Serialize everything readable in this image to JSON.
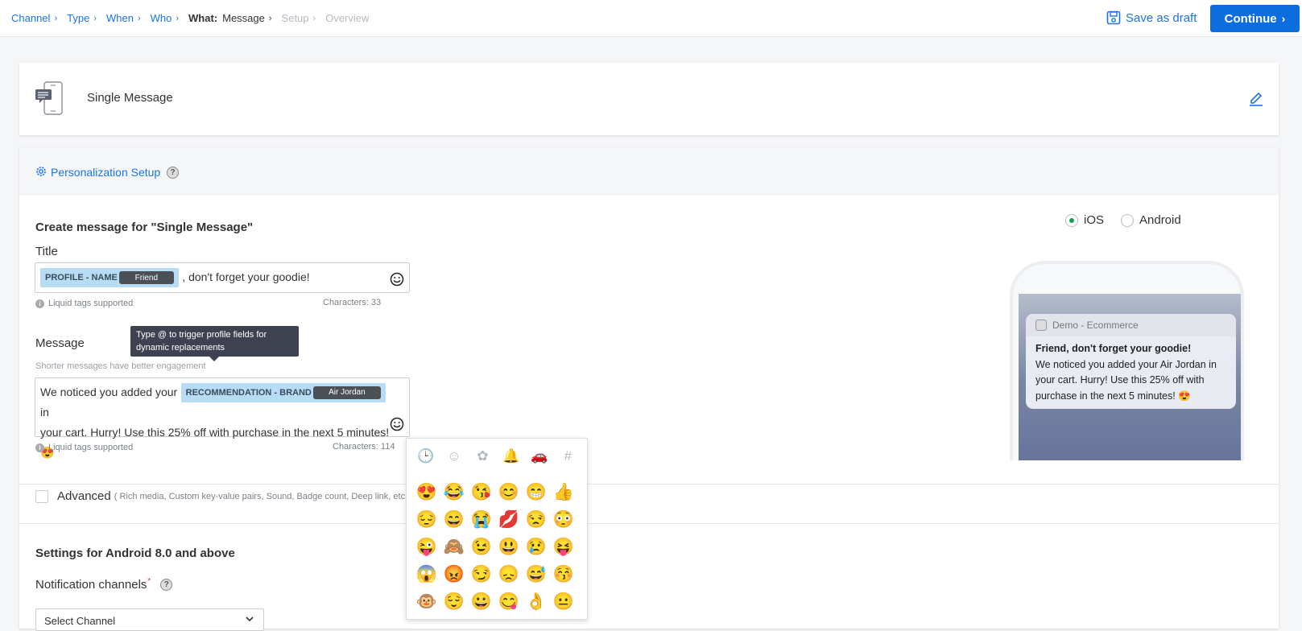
{
  "breadcrumb": {
    "items": [
      "Channel",
      "Type",
      "When",
      "Who"
    ],
    "current_prefix": "What:",
    "current_label": "Message",
    "disabled": [
      "Setup",
      "Overview"
    ]
  },
  "actions": {
    "save_draft": "Save as draft",
    "continue": "Continue"
  },
  "campaign": {
    "name": "Single Message"
  },
  "personalization": {
    "label": "Personalization Setup"
  },
  "form": {
    "heading": "Create message for \"Single Message\"",
    "platforms": [
      {
        "label": "iOS",
        "selected": true
      },
      {
        "label": "Android",
        "selected": false
      }
    ],
    "title": {
      "label": "Title",
      "tag_name": "PROFILE - NAME",
      "tag_value": "Friend",
      "text_after": ", don't forget your goodie!",
      "hint": "Liquid tags supported",
      "characters": "Characters: 33"
    },
    "message": {
      "label": "Message",
      "sub": "Shorter messages have better engagement",
      "text_before": "We noticed you added your",
      "tag_name": "RECOMMENDATION - BRAND",
      "tag_value": "Air Jordan",
      "text_after_1": "in",
      "text_after_2": "your cart. Hurry! Use this 25% off with purchase in the next 5 minutes! 😍",
      "hint": "Liquid tags supported",
      "characters": "Characters: 114"
    },
    "tooltip": "Type @ to trigger profile fields for dynamic replacements"
  },
  "advanced": {
    "label": "Advanced",
    "sub": "( Rich media, Custom key-value pairs, Sound, Badge count, Deep link, etc. )"
  },
  "android": {
    "heading": "Settings for Android 8.0 and above",
    "channels_label": "Notification channels",
    "required_mark": "*",
    "select_placeholder": "Select Channel"
  },
  "preview": {
    "app_name": "Demo - Ecommerce",
    "title": "Friend, don't forget your goodie!",
    "body": "We noticed you added your Air Jordan in your cart. Hurry! Use this 25% off with purchase in the next 5 minutes! 😍"
  },
  "emoji_picker": {
    "tabs": [
      "clock-icon",
      "smiley-icon",
      "flower-icon",
      "bell-icon",
      "car-icon",
      "hash-icon"
    ],
    "tab_glyphs": [
      "🕒",
      "☺",
      "✿",
      "🔔",
      "🚗",
      "#"
    ],
    "emojis": [
      "😍",
      "😂",
      "😘",
      "😊",
      "😁",
      "👍",
      "😔",
      "😄",
      "😭",
      "💋",
      "😒",
      "😳",
      "😜",
      "🙈",
      "😉",
      "😃",
      "😢",
      "😝",
      "😱",
      "😡",
      "😏",
      "😞",
      "😅",
      "😚",
      "🐵",
      "😌",
      "😀",
      "😋",
      "👌",
      "😐"
    ]
  },
  "colors": {
    "accent": "#1a73e8",
    "primary_button": "#0b6dde",
    "radio_selected": "#12a150",
    "tag_bg": "#b7dcf5"
  }
}
